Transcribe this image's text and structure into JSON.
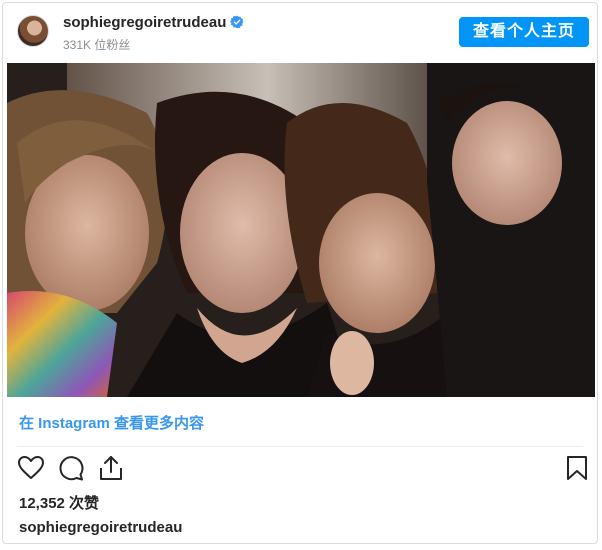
{
  "post": {
    "username": "sophiegregoiretrudeau",
    "followers": "331K 位粉丝",
    "view_profile_label": "查看个人主页",
    "view_more_label": "在 Instagram 查看更多内容",
    "likes": "12,352 次赞",
    "caption_username": "sophiegregoiretrudeau",
    "verified": true
  },
  "icons": {
    "verified": "verified-badge-icon",
    "like": "heart-icon",
    "comment": "comment-bubble-icon",
    "share": "share-icon",
    "save": "bookmark-icon"
  },
  "colors": {
    "accent": "#0095f6",
    "link": "#3897f0",
    "text": "#262626",
    "muted": "#8e8e8e",
    "border": "#dbdbdb"
  }
}
